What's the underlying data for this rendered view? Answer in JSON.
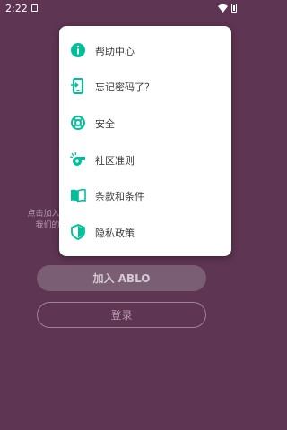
{
  "status_bar": {
    "time": "2:22"
  },
  "background": {
    "hint_line1": "点击加入 A",
    "hint_line2": "我们的"
  },
  "buttons": {
    "join": "加入 ABLO",
    "login": "登录"
  },
  "colors": {
    "background": "#5e3553",
    "accent": "#00c09a",
    "menu_bg": "#ffffff"
  },
  "menu": {
    "items": [
      {
        "label": "帮助中心",
        "icon": "info-icon"
      },
      {
        "label": "忘记密码了？",
        "icon": "phone-login-icon"
      },
      {
        "label": "安全",
        "icon": "lifebuoy-icon"
      },
      {
        "label": "社区准则",
        "icon": "whistle-icon"
      },
      {
        "label": "条款和条件",
        "icon": "book-icon"
      },
      {
        "label": "隐私政策",
        "icon": "shield-icon"
      }
    ]
  }
}
